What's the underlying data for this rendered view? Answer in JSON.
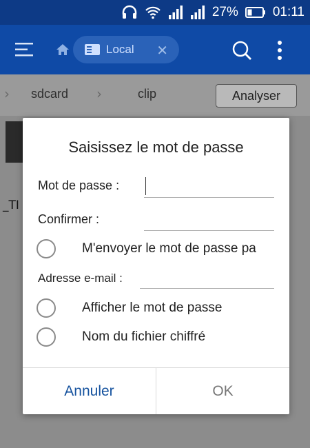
{
  "status_bar": {
    "battery_percent": "27%",
    "time": "01:11",
    "icons": [
      "headset-icon",
      "wifi-icon",
      "signal-icon",
      "signal-icon",
      "battery-icon"
    ]
  },
  "app_bar": {
    "location_label": "Local",
    "icons": [
      "hamburger-menu-icon",
      "home-icon",
      "storage-icon",
      "close-icon",
      "search-icon",
      "more-vert-icon"
    ]
  },
  "path_bar": {
    "crumbs": [
      "sdcard",
      "clip"
    ],
    "analyse_label": "Analyser"
  },
  "background": {
    "file_label": "_TI"
  },
  "dialog": {
    "title": "Saisissez le mot de passe",
    "password_label": "Mot de passe :",
    "confirm_label": "Confirmer :",
    "send_password_label": "M'envoyer le mot de passe pa",
    "email_label": "Adresse e-mail :",
    "show_password_label": "Afficher le mot de passe",
    "encrypt_filename_label": "Nom du fichier chiffré",
    "cancel_label": "Annuler",
    "ok_label": "OK",
    "password_value": "",
    "confirm_value": "",
    "email_value": ""
  },
  "colors": {
    "status_bar": "#0d3a86",
    "app_bar": "#0f4aa6",
    "accent": "#15529e"
  }
}
